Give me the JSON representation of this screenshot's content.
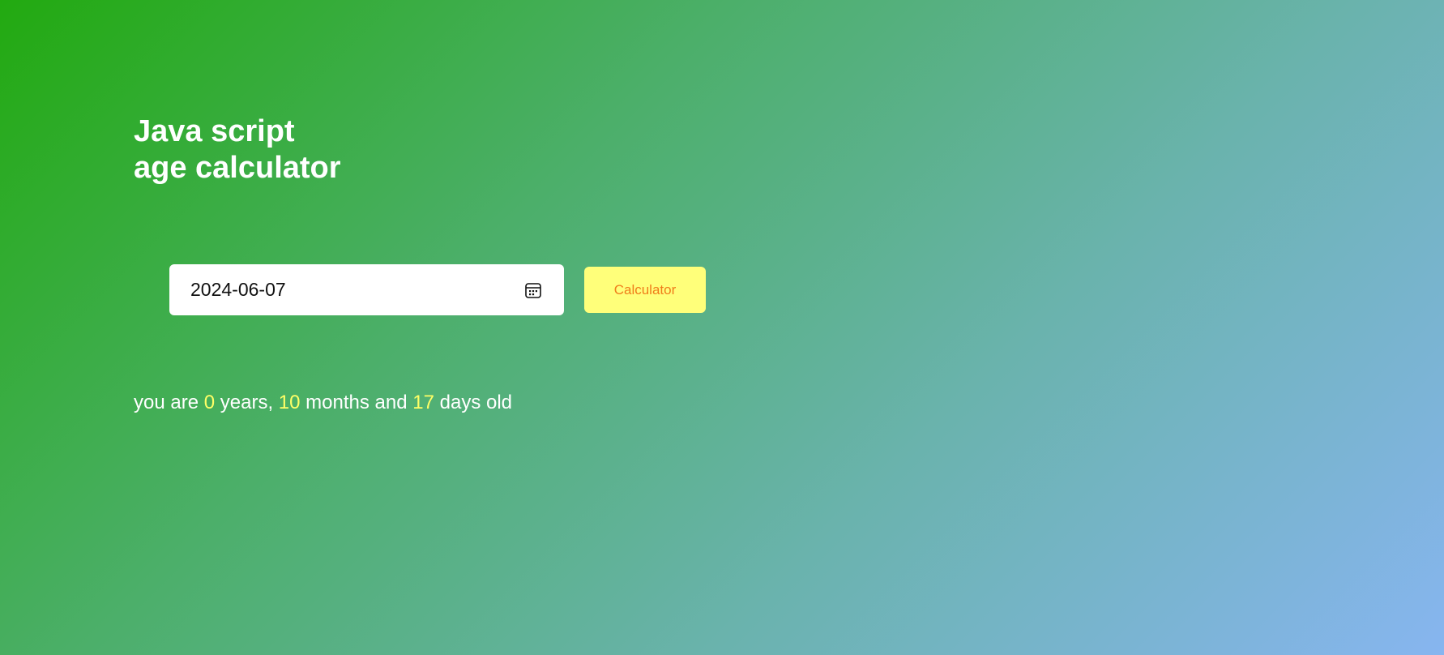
{
  "title": {
    "line1": "Java script",
    "line2": "age calculator"
  },
  "date_input": {
    "value": "2024-06-07",
    "icon": "calendar-icon"
  },
  "calculate_button": {
    "label": "Calculator"
  },
  "result": {
    "prefix": "you are",
    "years": "0",
    "years_label": "years,",
    "months": "10",
    "months_label": "months and",
    "days": "17",
    "days_label": "days old"
  },
  "colors": {
    "gradient_start": "#22aa10",
    "gradient_end": "#87b5f0",
    "button_background": "#ffff7a",
    "button_text": "#f07d1a",
    "highlight_number": "#ffff66",
    "text": "#ffffff"
  }
}
